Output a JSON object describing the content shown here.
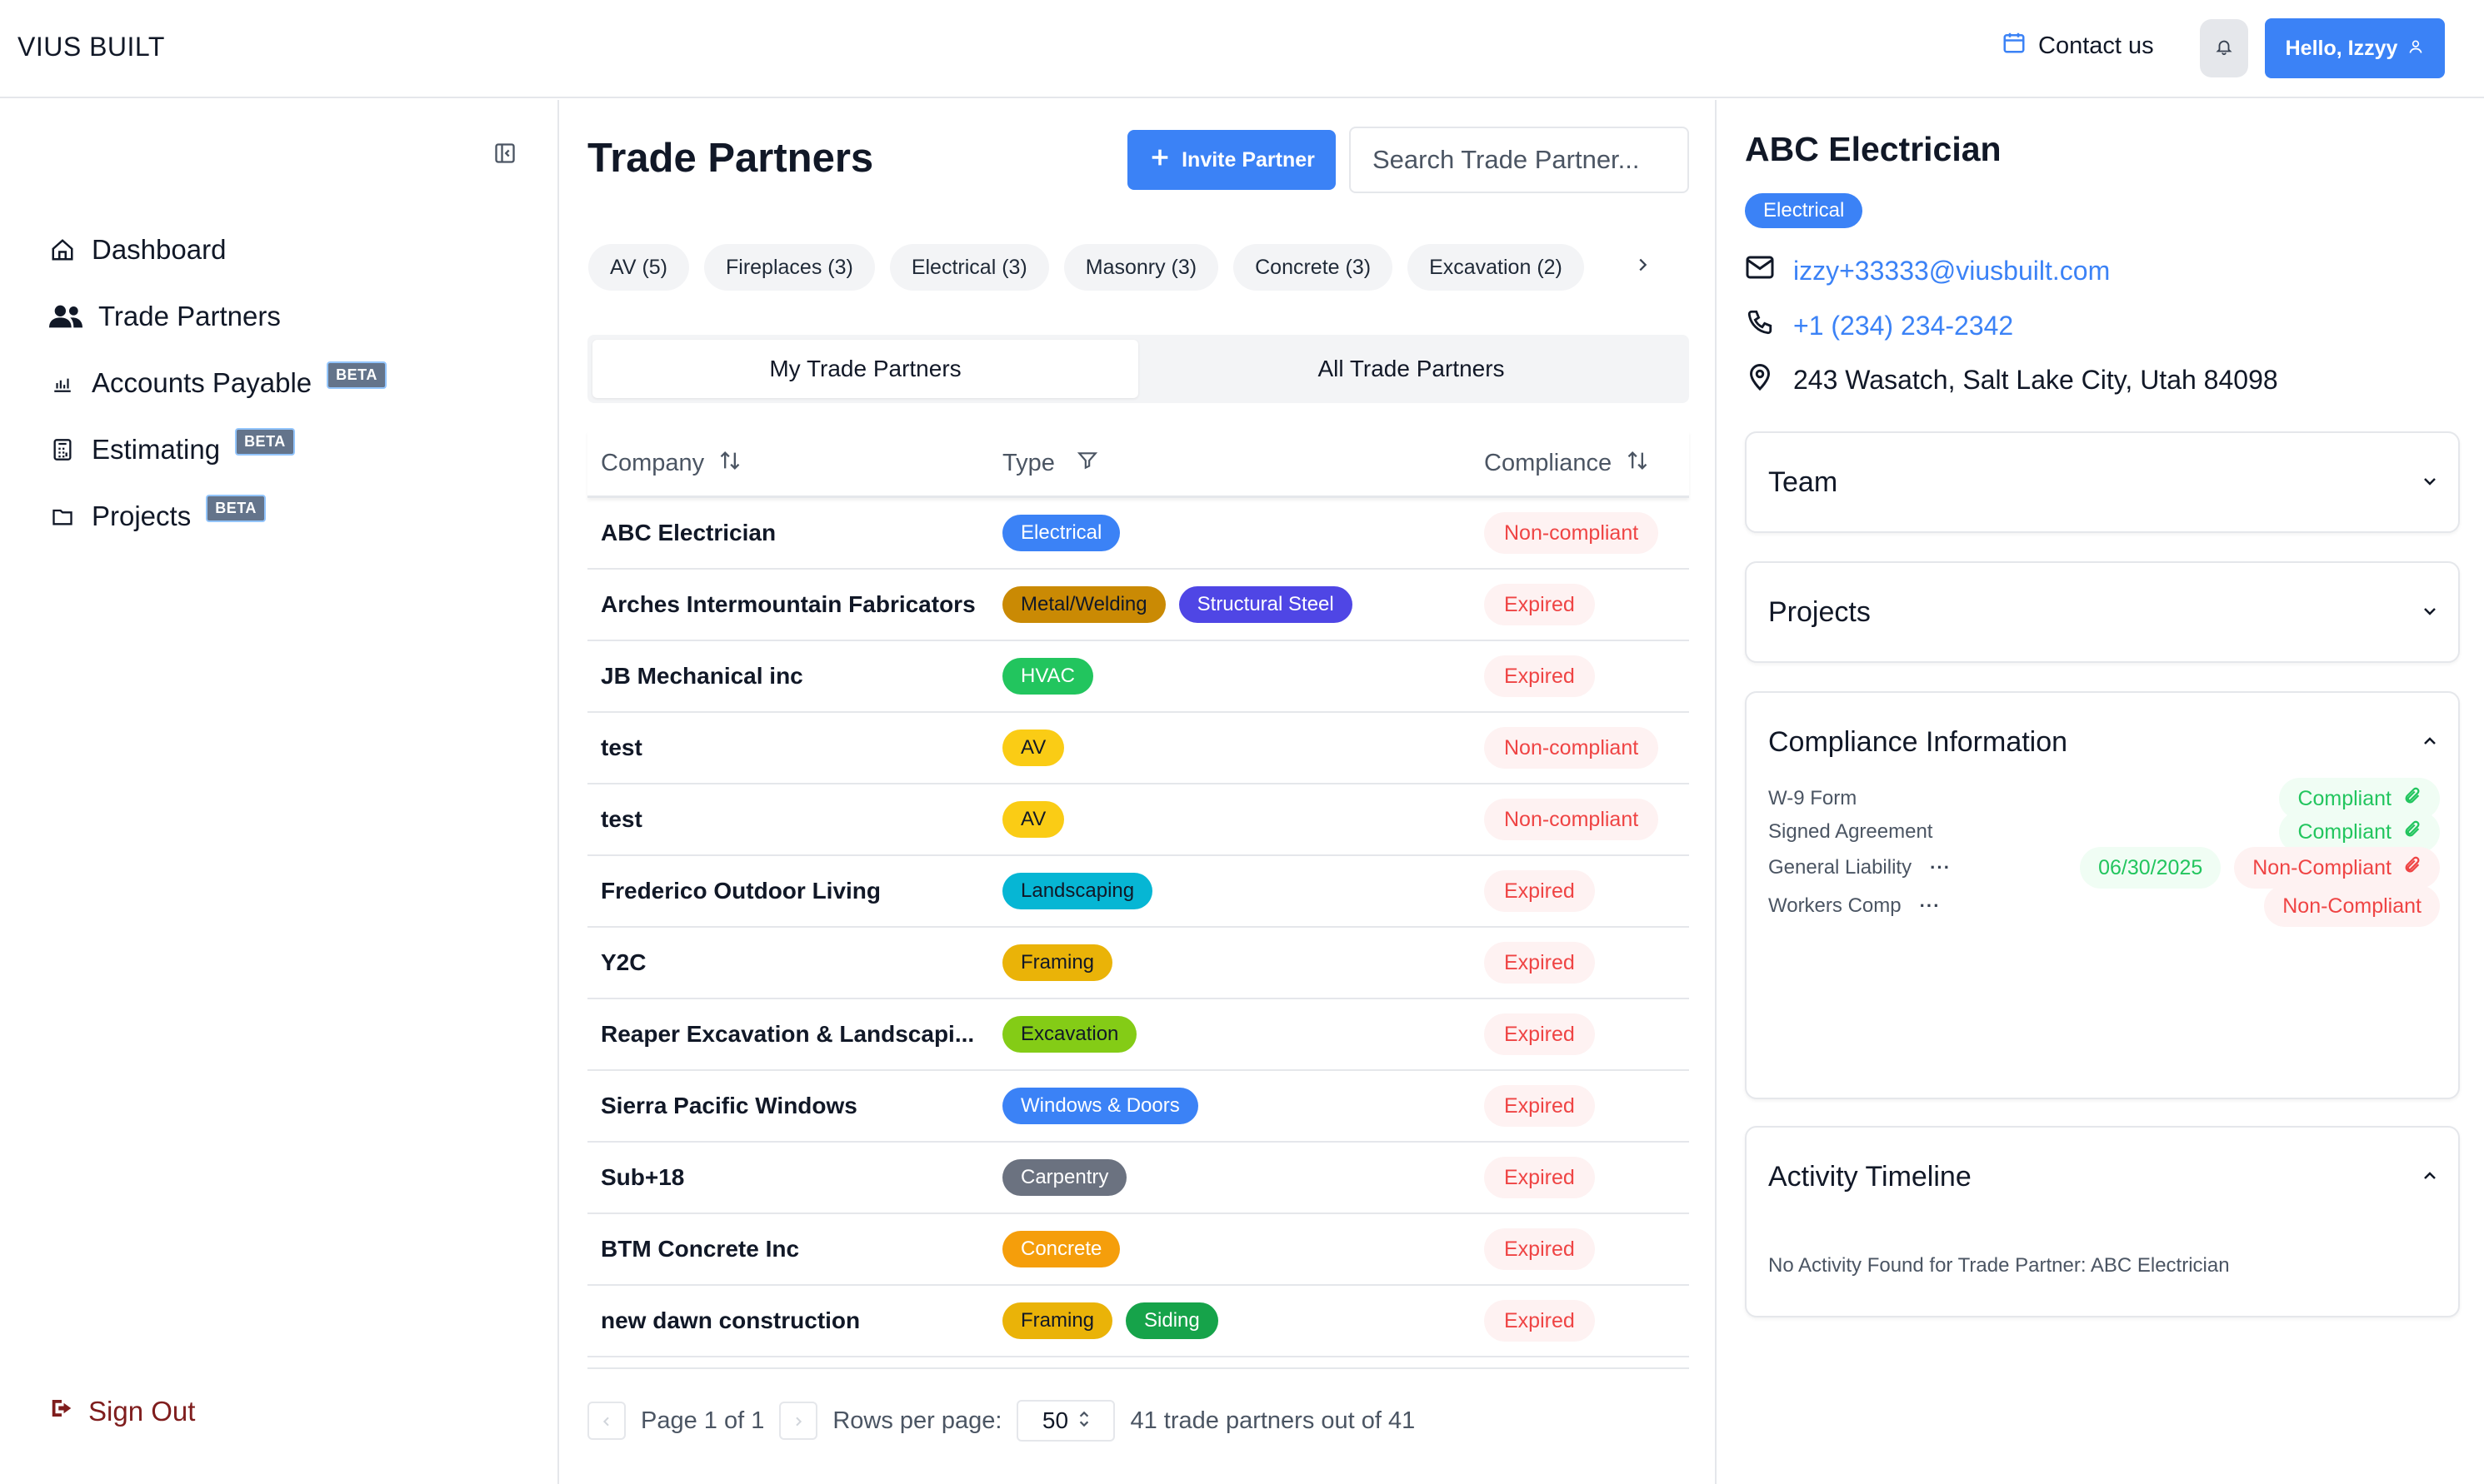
{
  "header": {
    "brand": "VIUS BUILT",
    "contact_label": "Contact us",
    "user_greeting": "Hello, Izzyy"
  },
  "sidebar": {
    "items": [
      {
        "label": "Dashboard",
        "icon": "home-icon",
        "beta": ""
      },
      {
        "label": "Trade Partners",
        "icon": "users-icon",
        "beta": ""
      },
      {
        "label": "Accounts Payable",
        "icon": "bar-chart-icon",
        "beta": "BETA"
      },
      {
        "label": "Estimating",
        "icon": "calculator-icon",
        "beta": "BETA"
      },
      {
        "label": "Projects",
        "icon": "folder-icon",
        "beta": "BETA"
      }
    ],
    "sign_out": "Sign Out"
  },
  "main": {
    "title": "Trade Partners",
    "invite_label": "Invite Partner",
    "search_placeholder": "Search Trade Partner...",
    "chips": [
      "AV (5)",
      "Fireplaces (3)",
      "Electrical (3)",
      "Masonry (3)",
      "Concrete (3)",
      "Excavation (2)"
    ],
    "tabs": [
      "My Trade Partners",
      "All Trade Partners"
    ],
    "columns": {
      "company": "Company",
      "type": "Type",
      "compliance": "Compliance"
    },
    "rows": [
      {
        "company": "ABC Electrician",
        "types": [
          {
            "label": "Electrical",
            "bg": "#3b82f6",
            "fg": "#ffffff"
          }
        ],
        "compliance": "Non-compliant"
      },
      {
        "company": "Arches Intermountain Fabricators",
        "types": [
          {
            "label": "Metal/Welding",
            "bg": "#ca8a04",
            "fg": "#111827"
          },
          {
            "label": "Structural Steel",
            "bg": "#4f46e5",
            "fg": "#ffffff"
          }
        ],
        "compliance": "Expired"
      },
      {
        "company": "JB Mechanical inc",
        "types": [
          {
            "label": "HVAC",
            "bg": "#22c55e",
            "fg": "#ffffff"
          }
        ],
        "compliance": "Expired"
      },
      {
        "company": "test",
        "types": [
          {
            "label": "AV",
            "bg": "#facc15",
            "fg": "#111827"
          }
        ],
        "compliance": "Non-compliant"
      },
      {
        "company": "test",
        "types": [
          {
            "label": "AV",
            "bg": "#facc15",
            "fg": "#111827"
          }
        ],
        "compliance": "Non-compliant"
      },
      {
        "company": "Frederico Outdoor Living",
        "types": [
          {
            "label": "Landscaping",
            "bg": "#06b6d4",
            "fg": "#111827"
          }
        ],
        "compliance": "Expired"
      },
      {
        "company": "Y2C",
        "types": [
          {
            "label": "Framing",
            "bg": "#eab308",
            "fg": "#111827"
          }
        ],
        "compliance": "Expired"
      },
      {
        "company": "Reaper Excavation & Landscapi...",
        "types": [
          {
            "label": "Excavation",
            "bg": "#84cc16",
            "fg": "#111827"
          }
        ],
        "compliance": "Expired"
      },
      {
        "company": "Sierra Pacific Windows",
        "types": [
          {
            "label": "Windows & Doors",
            "bg": "#3b82f6",
            "fg": "#ffffff"
          }
        ],
        "compliance": "Expired"
      },
      {
        "company": "Sub+18",
        "types": [
          {
            "label": "Carpentry",
            "bg": "#6b7280",
            "fg": "#ffffff"
          }
        ],
        "compliance": "Expired"
      },
      {
        "company": "BTM Concrete Inc",
        "types": [
          {
            "label": "Concrete",
            "bg": "#f59e0b",
            "fg": "#ffffff"
          }
        ],
        "compliance": "Expired"
      },
      {
        "company": "new dawn construction",
        "types": [
          {
            "label": "Framing",
            "bg": "#eab308",
            "fg": "#111827"
          },
          {
            "label": "Siding",
            "bg": "#16a34a",
            "fg": "#ffffff"
          }
        ],
        "compliance": "Expired"
      }
    ],
    "pager": {
      "page_text": "Page 1 of 1",
      "rows_label": "Rows per page:",
      "rows_value": "50",
      "total_text": "41 trade partners out of 41"
    }
  },
  "detail": {
    "name": "ABC Electrician",
    "badge": "Electrical",
    "email": "izzy+33333@viusbuilt.com",
    "phone": "+1 (234) 234-2342",
    "address": "243 Wasatch, Salt Lake City, Utah 84098",
    "sections": {
      "team": "Team",
      "projects": "Projects",
      "compliance": "Compliance Information",
      "activity": "Activity Timeline"
    },
    "compliance_items": [
      {
        "label": "W-9 Form",
        "date": "",
        "status": "Compliant",
        "ok": true,
        "attach": true,
        "menu": false
      },
      {
        "label": "Signed Agreement",
        "date": "",
        "status": "Compliant",
        "ok": true,
        "attach": true,
        "menu": false
      },
      {
        "label": "General Liability",
        "date": "06/30/2025",
        "status": "Non-Compliant",
        "ok": false,
        "attach": true,
        "menu": true
      },
      {
        "label": "Workers Comp",
        "date": "",
        "status": "Non-Compliant",
        "ok": false,
        "attach": false,
        "menu": true
      }
    ],
    "no_activity": "No Activity Found for Trade Partner: ABC Electrician"
  }
}
